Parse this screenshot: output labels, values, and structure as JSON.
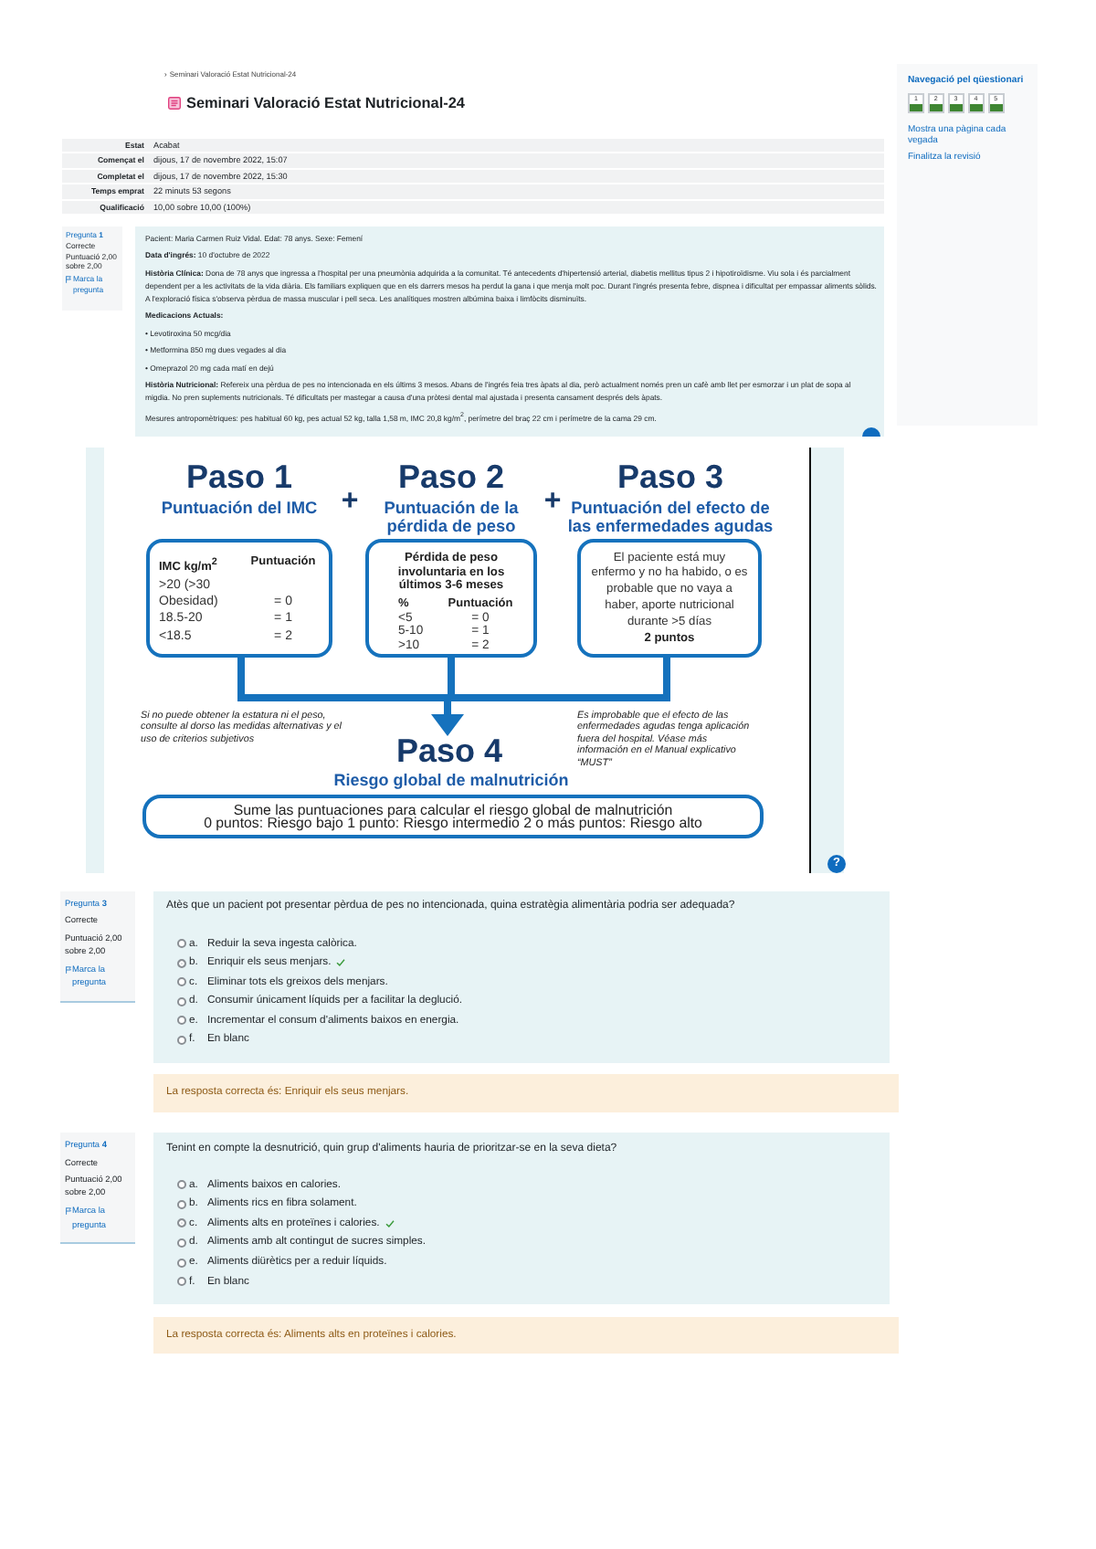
{
  "breadcrumb": {
    "separator": "›",
    "label": "Seminari Valoració Estat Nutricional-24"
  },
  "title": "Seminari Valoració Estat Nutricional-24",
  "summary": [
    {
      "label": "Estat",
      "value": "Acabat"
    },
    {
      "label": "Començat el",
      "value": "dijous, 17 de novembre 2022, 15:07"
    },
    {
      "label": "Completat el",
      "value": "dijous, 17 de novembre 2022, 15:30"
    },
    {
      "label": "Temps emprat",
      "value": "22 minuts 53 segons"
    },
    {
      "label": "Qualificació",
      "value": "10,00 sobre 10,00 (100%)"
    }
  ],
  "quiz_nav": {
    "title": "Navegació pel qüestionari",
    "items": [
      {
        "label": "1",
        "correct": true
      },
      {
        "label": "2",
        "correct": true
      },
      {
        "label": "3",
        "correct": true
      },
      {
        "label": "4",
        "correct": true
      },
      {
        "label": "5",
        "correct": true
      }
    ],
    "links": [
      "Mostra una pàgina cada vegada",
      "Finalitza la revisió"
    ]
  },
  "case_question": {
    "info": {
      "number": "Pregunta **1**",
      "status": "Correcte",
      "grade": "Puntuació 2,00 sobre 2,00",
      "flag": "Marca la pregunta"
    },
    "paragraphs": [
      {
        "kind": "text",
        "text": "Pacient: Maria Carmen Ruiz Vidal. Edat: 78 anys. Sexe: Femení"
      },
      {
        "kind": "text",
        "text": "**Data d'ingrés:** 10 d'octubre de 2022"
      },
      {
        "kind": "text",
        "text": "**Història Clínica:** Dona de 78 anys que ingressa a l'hospital per una pneumònia adquirida a la comunitat. Té antecedents d'hipertensió arterial, diabetis mellitus tipus 2 i hipotiroïdisme. Viu sola i és parcialment dependent per a les activitats de la vida diària. Els familiars expliquen que en els darrers mesos ha perdut la gana i que menja molt poc. Durant l'ingrés presenta febre, dispnea i dificultat per empassar aliments sòlids. A l'exploració física s'observa pèrdua de massa muscular i pell seca. Les analítiques mostren albúmina baixa i limfòcits disminuïts."
      },
      {
        "kind": "heading",
        "text": "Medicacions Actuals:"
      },
      {
        "kind": "bullet",
        "text": "• Levotiroxina 50 mcg/dia"
      },
      {
        "kind": "bullet",
        "text": "• Metformina 850 mg dues vegades al dia"
      },
      {
        "kind": "bullet",
        "text": "• Omeprazol 20 mg cada matí en dejú"
      },
      {
        "kind": "text",
        "text": "**Història Nutricional:** Refereix una pèrdua de pes no intencionada en els últims 3 mesos. Abans de l'ingrés feia tres àpats al dia, però actualment només pren un cafè amb llet per esmorzar i un plat de sopa al migdia. No pren suplements nutricionals. Té dificultats per mastegar a causa d'una pròtesi dental mal ajustada i presenta cansament després dels àpats."
      },
      {
        "kind": "text",
        "text": "Mesures antropomètriques: pes habitual 60 kg, pes actual 52 kg, talla 1,58 m, IMC 20,8 kg/m$^{2}$, perímetre del braç 22 cm i perímetre de la cama 29 cm."
      }
    ]
  },
  "figure": {
    "steps": [
      {
        "title": "Paso 1",
        "subtitle": "Puntuación del IMC"
      },
      {
        "title": "Paso 2",
        "subtitle": "Puntuación de la pérdida de peso"
      },
      {
        "title": "Paso 3",
        "subtitle": "Puntuación del efecto de las enfermedades agudas"
      }
    ],
    "plus_signs": [
      "+",
      "+"
    ],
    "bmi_box": {
      "headers": [
        "IMC kg/m$^{2}$",
        "Puntuación"
      ],
      "rows": [
        [
          ">20 (>30 Obesidad)",
          "= 0"
        ],
        [
          "18.5-20",
          "= 1"
        ],
        [
          "<18.5",
          "= 2"
        ]
      ]
    },
    "weight_box": {
      "caption": "Pérdida de peso involuntaria en los últimos 3-6 meses",
      "headers": [
        "%",
        "Puntuación"
      ],
      "rows": [
        [
          "<5",
          "= 0"
        ],
        [
          "5-10",
          "= 1"
        ],
        [
          ">10",
          "= 2"
        ]
      ]
    },
    "illness_box": {
      "text": "El paciente está muy enfermo y no ha habido, o es probable que no vaya a haber, aporte nutricional durante >5 días",
      "points": "2 puntos"
    },
    "notes": [
      "Si no puede obtener la estatura ni el peso, consulte al dorso las medidas alternativas y el uso de criterios subjetivos",
      "Es improbable que el efecto de las enfermedades agudas tenga aplicación fuera del hospital. Véase más información en el Manual explicativo “MUST”"
    ],
    "final": {
      "title": "Paso 4",
      "subtitle": "Riesgo global de malnutrición",
      "lines": [
        "Sume las puntuaciones para calcular el riesgo global de malnutrición",
        "0 puntos: Riesgo bajo 1 punto: Riesgo intermedio 2 o más puntos: Riesgo alto"
      ]
    },
    "help_button": "?"
  },
  "questions": [
    {
      "info": {
        "number": "Pregunta **3**",
        "status": "Correcte",
        "grade": "Puntuació 2,00 sobre 2,00",
        "flag": "Marca la pregunta"
      },
      "prompt": "Atès que un pacient pot presentar pèrdua de pes no intencionada, quina estratègia alimentària podria ser adequada?",
      "options": [
        {
          "letter": "a.",
          "text": "Reduir la seva ingesta calòrica.",
          "selected": false,
          "correct": false
        },
        {
          "letter": "b.",
          "text": "Enriquir els seus menjars.",
          "selected": true,
          "correct": true
        },
        {
          "letter": "c.",
          "text": "Eliminar tots els greixos dels menjars.",
          "selected": false,
          "correct": false
        },
        {
          "letter": "d.",
          "text": "Consumir únicament líquids per a facilitar la deglució.",
          "selected": false,
          "correct": false
        },
        {
          "letter": "e.",
          "text": "Incrementar el consum d'aliments baixos en energia.",
          "selected": false,
          "correct": false
        },
        {
          "letter": "f.",
          "text": "En blanc",
          "selected": false,
          "correct": false
        }
      ],
      "feedback": "La resposta correcta és: Enriquir els seus menjars."
    },
    {
      "info": {
        "number": "Pregunta **4**",
        "status": "Correcte",
        "grade": "Puntuació 2,00 sobre 2,00",
        "flag": "Marca la pregunta"
      },
      "prompt": "Tenint en compte la desnutrició, quin grup d'aliments hauria de prioritzar-se en la seva dieta?",
      "options": [
        {
          "letter": "a.",
          "text": "Aliments baixos en calories.",
          "selected": false,
          "correct": false
        },
        {
          "letter": "b.",
          "text": "Aliments rics en fibra solament.",
          "selected": false,
          "correct": false
        },
        {
          "letter": "c.",
          "text": "Aliments alts en proteïnes i calories.",
          "selected": true,
          "correct": true
        },
        {
          "letter": "d.",
          "text": "Aliments amb alt contingut de sucres simples.",
          "selected": false,
          "correct": false
        },
        {
          "letter": "e.",
          "text": "Aliments diürètics per a reduir líquids.",
          "selected": false,
          "correct": false
        },
        {
          "letter": "f.",
          "text": "En blanc",
          "selected": false,
          "correct": false
        }
      ],
      "feedback": "La resposta correcta és: Aliments alts en proteïnes i calories."
    }
  ]
}
